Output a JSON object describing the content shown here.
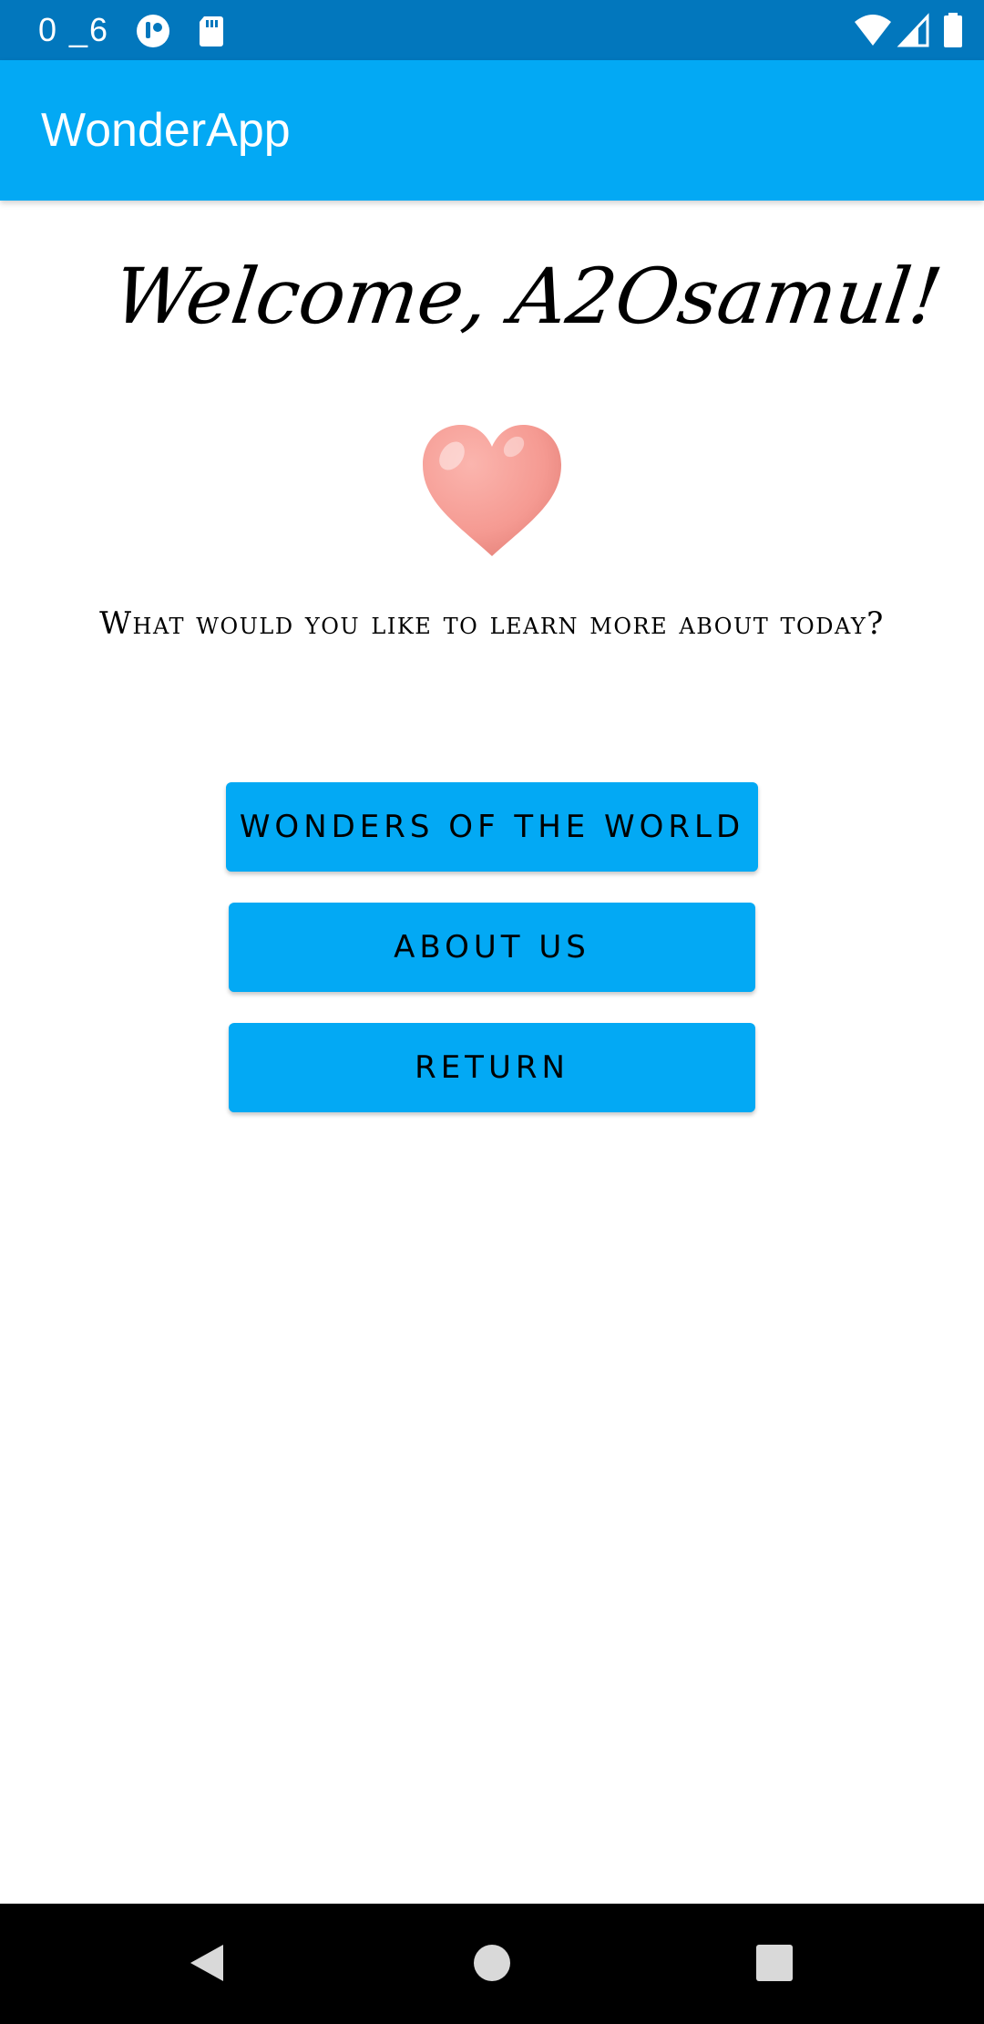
{
  "status_bar": {
    "time": "0 _6",
    "icons": [
      "notification-app-icon",
      "sd-card-icon",
      "wifi-icon",
      "cell-signal-icon",
      "battery-icon"
    ]
  },
  "app_bar": {
    "title": "WonderApp"
  },
  "main": {
    "welcome_text": "Welcome, A2Osamul!",
    "heart_icon": "heart-icon",
    "question": "What would you like to learn more about today?",
    "buttons": {
      "wonders": "WONDERS OF THE WORLD",
      "about": "ABOUT US",
      "return": "RETURN"
    }
  },
  "nav_bar": {
    "icons": [
      "back-icon",
      "home-icon",
      "recents-icon"
    ]
  },
  "colors": {
    "status_bar": "#0277BD",
    "app_bar": "#03A9F4",
    "button": "#03A9F4",
    "heart": "#F8A19A",
    "nav_bar": "#000000"
  }
}
